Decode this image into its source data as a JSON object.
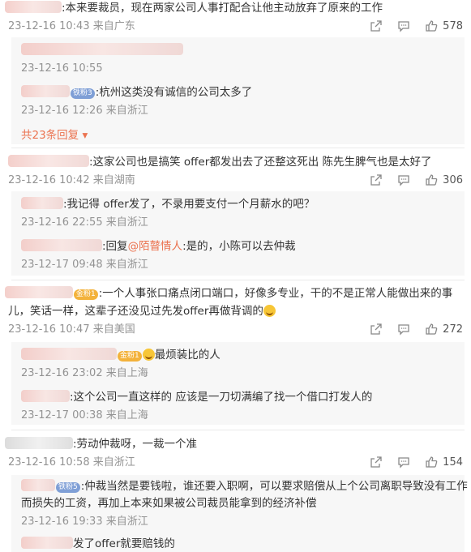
{
  "comments": [
    {
      "text": ":本来要裁员，现在两家公司人事打配合让他主动放弃了原来的工作",
      "time": "23-12-16 10:43 来自广东",
      "likes": "578",
      "replies": [
        {
          "text": "",
          "time": "23-12-16 10:55"
        },
        {
          "text": ":杭州这类没有诚信的公司太多了",
          "badge": "铁粉3",
          "time": "23-12-16 12:26 来自浙江"
        }
      ],
      "more": "共23条回复"
    },
    {
      "text": ":这家公司也是搞笑 offer都发出去了还整这死出 陈先生脾气也是太好了",
      "time": "23-12-16 10:42 来自湖南",
      "likes": "306",
      "replies": [
        {
          "text": ":我记得 offer发了，不录用要支付一个月薪水的吧？",
          "time": "23-12-16 22:55 来自浙江"
        },
        {
          "text_prefix": ":回复",
          "mention": "@陌瞽情人",
          "text": ":是的，小陈可以去仲裁",
          "time": "23-12-17 09:48 来自浙江"
        }
      ]
    },
    {
      "badge": "金粉1",
      "text_line1": ":一个人事张口痛点闭口端口，好像多专业，干的不是正常人能做出来的事",
      "text_line2": "儿，笑话一样，这辈子还没见过先发offer再做背调的",
      "time": "23-12-16 10:47 来自美国",
      "likes": "272",
      "replies": [
        {
          "badge": "金粉1",
          "text": "最烦装比的人",
          "time": "23-12-16 23:02 来自上海"
        },
        {
          "text": ":这个公司一直这样的 应该是一刀切满编了找一个借口打发人的",
          "time": "23-12-17 00:38 来自上海"
        }
      ]
    },
    {
      "text": ":劳动仲裁呀，一裁一个准",
      "time": "23-12-16 10:58 来自浙江",
      "likes": "154",
      "replies": [
        {
          "badge": "铁粉5",
          "text_line1": ":仲裁当然是要钱啦，谁还要入职啊，可以要求赔偿从上个公司离职导致没有工作",
          "text_line2": "而损失的工资，再加上本来如果被公司裁员能拿到的经济补偿",
          "time": "23-12-16 19:33 来自浙江"
        },
        {
          "text": "发了offer就要赔钱的"
        }
      ]
    }
  ],
  "icons": {
    "share": "share-icon",
    "comment": "comment-icon",
    "like": "thumbs-up-icon"
  },
  "colors": {
    "accent": "#eb7350",
    "meta": "#939393",
    "reply_bg": "#f7f7f7"
  }
}
